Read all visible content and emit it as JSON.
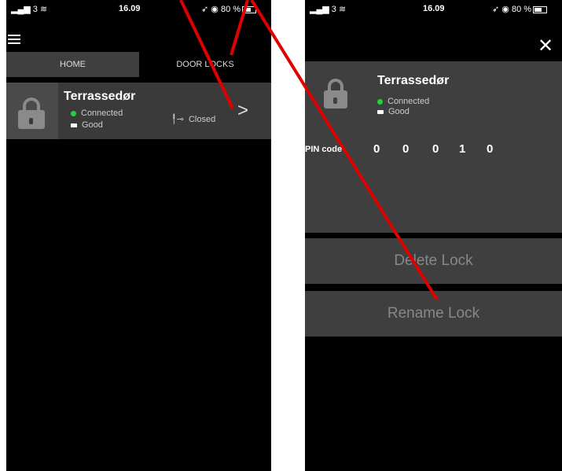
{
  "left": {
    "status": {
      "signal": "3",
      "time": "16.09",
      "battery": "80 %"
    },
    "tabs": {
      "home": "HOME",
      "door_locks": "DOOR LOCKS"
    },
    "lock": {
      "name": "Terrassedør",
      "connection": "Connected",
      "battery": "Good",
      "door_state": "Closed"
    }
  },
  "right": {
    "status": {
      "signal": "3",
      "time": "16.09",
      "battery": "80 %"
    },
    "lock": {
      "name": "Terrassedør",
      "connection": "Connected",
      "battery": "Good"
    },
    "pin": {
      "label": "PIN code",
      "digits": [
        "0",
        "0",
        "0",
        "1",
        "0"
      ]
    },
    "delete_label": "Delete Lock",
    "rename_label": "Rename Lock"
  },
  "colors": {
    "connected": "#23d23a",
    "annotation": "#e00000"
  }
}
